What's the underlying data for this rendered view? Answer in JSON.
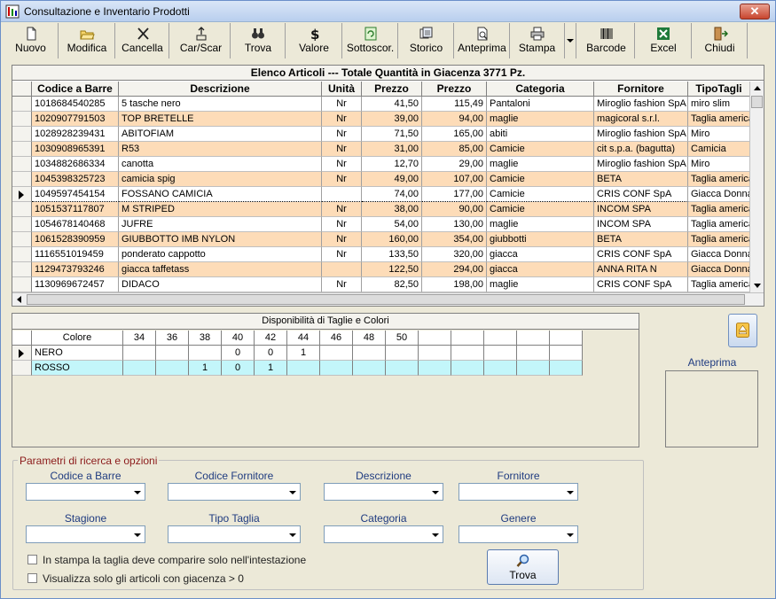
{
  "window": {
    "title": "Consultazione e Inventario Prodotti",
    "close_label": "✕"
  },
  "toolbar": [
    {
      "id": "nuovo",
      "label": "Nuovo",
      "icon": "new-document-icon"
    },
    {
      "id": "modifica",
      "label": "Modifica",
      "icon": "open-folder-icon"
    },
    {
      "id": "cancella",
      "label": "Cancella",
      "icon": "delete-x-icon"
    },
    {
      "id": "carscar",
      "label": "Car/Scar",
      "icon": "load-unload-icon"
    },
    {
      "id": "trova",
      "label": "Trova",
      "icon": "binoculars-icon"
    },
    {
      "id": "valore",
      "label": "Valore",
      "icon": "dollar-icon"
    },
    {
      "id": "sottoscor",
      "label": "Sottoscor.",
      "icon": "refresh-stock-icon"
    },
    {
      "id": "storico",
      "label": "Storico",
      "icon": "history-icon"
    },
    {
      "id": "anteprima",
      "label": "Anteprima",
      "icon": "print-preview-icon"
    },
    {
      "id": "stampa",
      "label": "Stampa",
      "icon": "printer-icon"
    },
    {
      "id": "barcode",
      "label": "Barcode",
      "icon": "barcode-icon"
    },
    {
      "id": "excel",
      "label": "Excel",
      "icon": "excel-icon"
    },
    {
      "id": "chiudi",
      "label": "Chiudi",
      "icon": "exit-door-icon"
    }
  ],
  "articles": {
    "caption": "Elenco Articoli --- Totale Quantità in Giacenza 3771 Pz.",
    "columns": [
      "Codice a Barre",
      "Descrizione",
      "Unità",
      "Prezzo",
      "Prezzo",
      "Categoria",
      "Fornitore",
      "TipoTagli"
    ],
    "rows": [
      {
        "code": "1018684540285",
        "desc": "5 tasche nero",
        "unit": "Nr",
        "price1": "41,50",
        "price2": "115,49",
        "cat": "Pantaloni",
        "supplier": "Miroglio fashion SpA",
        "size_type": "miro slim",
        "highlight": false,
        "selected": false
      },
      {
        "code": "1020907791503",
        "desc": "TOP BRETELLE",
        "unit": "Nr",
        "price1": "39,00",
        "price2": "94,00",
        "cat": "maglie",
        "supplier": "magicoral s.r.l.",
        "size_type": "Taglia americana",
        "highlight": true,
        "selected": false
      },
      {
        "code": "1028928239431",
        "desc": "ABITOFIAM",
        "unit": "Nr",
        "price1": "71,50",
        "price2": "165,00",
        "cat": "abiti",
        "supplier": "Miroglio fashion SpA",
        "size_type": "Miro",
        "highlight": false,
        "selected": false
      },
      {
        "code": "1030908965391",
        "desc": "R53",
        "unit": "Nr",
        "price1": "31,00",
        "price2": "85,00",
        "cat": "Camicie",
        "supplier": "cit s.p.a. (bagutta)",
        "size_type": "Camicia",
        "highlight": true,
        "selected": false
      },
      {
        "code": "1034882686334",
        "desc": "canotta",
        "unit": "Nr",
        "price1": "12,70",
        "price2": "29,00",
        "cat": "maglie",
        "supplier": "Miroglio fashion SpA",
        "size_type": "Miro",
        "highlight": false,
        "selected": false
      },
      {
        "code": "1045398325723",
        "desc": "camicia spig",
        "unit": "Nr",
        "price1": "49,00",
        "price2": "107,00",
        "cat": "Camicie",
        "supplier": "BETA",
        "size_type": "Taglia americana",
        "highlight": true,
        "selected": false
      },
      {
        "code": "1049597454154",
        "desc": "FOSSANO CAMICIA",
        "unit": "",
        "price1": "74,00",
        "price2": "177,00",
        "cat": "Camicie",
        "supplier": "CRIS CONF SpA",
        "size_type": "Giacca Donna",
        "highlight": false,
        "selected": true
      },
      {
        "code": "1051537117807",
        "desc": "M STRIPED",
        "unit": "Nr",
        "price1": "38,00",
        "price2": "90,00",
        "cat": "Camicie",
        "supplier": "INCOM SPA",
        "size_type": "Taglia americana",
        "highlight": true,
        "selected": false
      },
      {
        "code": "1054678140468",
        "desc": "JUFRE",
        "unit": "Nr",
        "price1": "54,00",
        "price2": "130,00",
        "cat": "maglie",
        "supplier": "INCOM SPA",
        "size_type": "Taglia americana",
        "highlight": false,
        "selected": false
      },
      {
        "code": "1061528390959",
        "desc": "GIUBBOTTO IMB NYLON",
        "unit": "Nr",
        "price1": "160,00",
        "price2": "354,00",
        "cat": "giubbotti",
        "supplier": "BETA",
        "size_type": "Taglia americana",
        "highlight": true,
        "selected": false
      },
      {
        "code": "1116551019459",
        "desc": "ponderato cappotto",
        "unit": "Nr",
        "price1": "133,50",
        "price2": "320,00",
        "cat": "giacca",
        "supplier": "CRIS CONF SpA",
        "size_type": "Giacca Donna",
        "highlight": false,
        "selected": false
      },
      {
        "code": "1129473793246",
        "desc": "giacca taffetass",
        "unit": "",
        "price1": "122,50",
        "price2": "294,00",
        "cat": "giacca",
        "supplier": "ANNA RITA N",
        "size_type": "Giacca Donna",
        "highlight": true,
        "selected": false
      },
      {
        "code": "1130969672457",
        "desc": "DIDACO",
        "unit": "Nr",
        "price1": "82,50",
        "price2": "198,00",
        "cat": "maglie",
        "supplier": "CRIS CONF SpA",
        "size_type": "Taglia americana",
        "highlight": false,
        "selected": false
      }
    ]
  },
  "sizes": {
    "caption": "Disponibilità di Taglie e Colori",
    "headers": [
      "Colore",
      "34",
      "36",
      "38",
      "40",
      "42",
      "44",
      "46",
      "48",
      "50",
      "",
      "",
      "",
      "",
      ""
    ],
    "rows": [
      {
        "color": "NERO",
        "values": [
          "",
          "",
          "",
          "0",
          "0",
          "1",
          "",
          "",
          "",
          "",
          "",
          "",
          "",
          ""
        ],
        "selected": true,
        "cyan": false
      },
      {
        "color": "ROSSO",
        "values": [
          "",
          "",
          "1",
          "0",
          "1",
          "",
          "",
          "",
          "",
          "",
          "",
          "",
          "",
          ""
        ],
        "selected": false,
        "cyan": true
      }
    ]
  },
  "preview": {
    "label": "Anteprima"
  },
  "params": {
    "legend": "Parametri di ricerca e opzioni",
    "fields": [
      {
        "id": "codice-a-barre",
        "label": "Codice a Barre",
        "value": ""
      },
      {
        "id": "codice-fornitore",
        "label": "Codice Fornitore",
        "value": ""
      },
      {
        "id": "descrizione",
        "label": "Descrizione",
        "value": ""
      },
      {
        "id": "fornitore",
        "label": "Fornitore",
        "value": ""
      },
      {
        "id": "stagione",
        "label": "Stagione",
        "value": ""
      },
      {
        "id": "tipo-taglia",
        "label": "Tipo Taglia",
        "value": ""
      },
      {
        "id": "categoria",
        "label": "Categoria",
        "value": ""
      },
      {
        "id": "genere",
        "label": "Genere",
        "value": ""
      }
    ],
    "checkboxes": [
      {
        "id": "print-size-header",
        "label": "In stampa la taglia deve comparire solo nell'intestazione",
        "checked": false
      },
      {
        "id": "only-in-stock",
        "label": "Visualizza solo gli articoli con giacenza > 0",
        "checked": false
      }
    ],
    "search_button": "Trova"
  },
  "colors": {
    "row_highlight": "#fddcb8",
    "row_cyan": "#c3f6fa",
    "legend_red": "#8b1a1a",
    "label_blue": "#1f3b80"
  }
}
